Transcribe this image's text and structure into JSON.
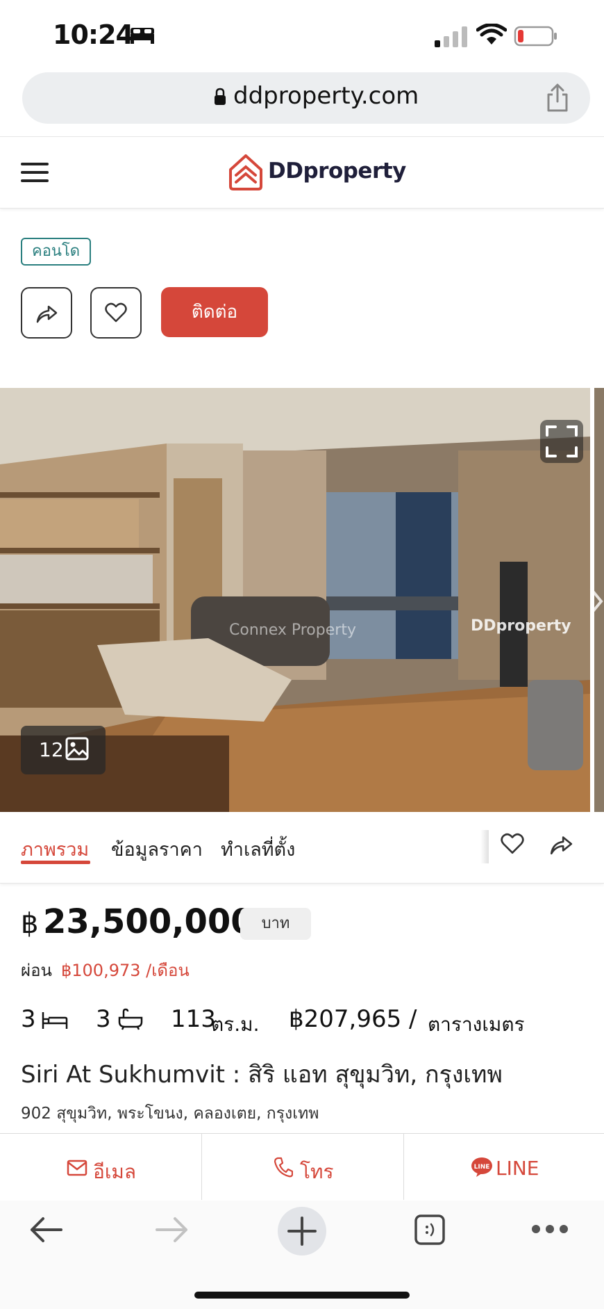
{
  "status_bar": {
    "time": "10:24",
    "battery_color": "#e53935"
  },
  "browser": {
    "url": "ddproperty.com"
  },
  "header": {
    "logo_text": "DDproperty",
    "brand_color": "#d5473a"
  },
  "listing": {
    "type_tag": "คอนโด",
    "contact_label": "ติดต่อ",
    "photo": {
      "watermark_brand": "DDproperty",
      "watermark_agent": "Connex Property",
      "photo_count": "12"
    },
    "tabs": [
      {
        "label": "ภาพรวม",
        "active": true
      },
      {
        "label": "ข้อมูลราคา",
        "active": false
      },
      {
        "label": "ทำเลที่ตั้ง",
        "active": false
      }
    ],
    "price": {
      "currency_symbol": "฿",
      "amount": "23,500,000",
      "unit": "บาท"
    },
    "installment": {
      "label": "ผ่อน",
      "value": "฿100,973 /เดือน"
    },
    "stats": {
      "bedrooms": "3",
      "bathrooms": "3",
      "area": "113",
      "area_unit": "ตร.ม.",
      "price_per_sqm": "฿207,965 /",
      "price_per_sqm_unit": "ตารางเมตร"
    },
    "title": "Siri At Sukhumvit : สิริ แอท สุขุมวิท, กรุงเทพ",
    "address": "902 สุขุมวิท, พระโขนง, คลองเตย, กรุงเทพ"
  },
  "contact_bar": {
    "email": "อีเมล",
    "phone": "โทร",
    "line": "LINE"
  },
  "icons": [
    "bed-icon",
    "signal-icon",
    "wifi-icon",
    "battery-icon",
    "lock-icon",
    "share-icon",
    "hamburger-icon",
    "logo-icon",
    "heart-icon",
    "expand-icon",
    "gallery-icon",
    "bath-icon",
    "mail-icon",
    "phone-icon",
    "line-icon",
    "back-arrow-icon",
    "forward-arrow-icon",
    "plus-icon",
    "tabs-icon",
    "more-icon"
  ]
}
